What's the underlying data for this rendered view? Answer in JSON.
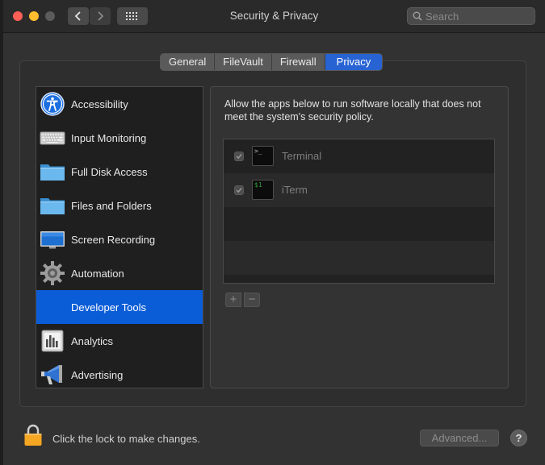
{
  "window": {
    "title": "Security & Privacy",
    "search_placeholder": "Search"
  },
  "tabs": [
    {
      "label": "General"
    },
    {
      "label": "FileVault"
    },
    {
      "label": "Firewall"
    },
    {
      "label": "Privacy",
      "active": true
    }
  ],
  "sidebar": {
    "items": [
      {
        "label": "Accessibility",
        "icon": "accessibility-icon"
      },
      {
        "label": "Input Monitoring",
        "icon": "keyboard-icon"
      },
      {
        "label": "Full Disk Access",
        "icon": "folder-icon"
      },
      {
        "label": "Files and Folders",
        "icon": "folder-icon"
      },
      {
        "label": "Screen Recording",
        "icon": "display-icon"
      },
      {
        "label": "Automation",
        "icon": "gear-icon"
      },
      {
        "label": "Developer Tools",
        "icon": "developer-tools-icon",
        "selected": true
      },
      {
        "label": "Analytics",
        "icon": "analytics-icon"
      },
      {
        "label": "Advertising",
        "icon": "megaphone-icon"
      }
    ]
  },
  "detail": {
    "description": "Allow the apps below to run software locally that does not meet the system's security policy.",
    "apps": [
      {
        "name": "Terminal",
        "checked": true,
        "icon": "terminal-icon",
        "icon_text": ">_"
      },
      {
        "name": "iTerm",
        "checked": true,
        "icon": "iterm-icon",
        "icon_text": "$1"
      }
    ],
    "add_label": "+",
    "remove_label": "−"
  },
  "footer": {
    "lock_text": "Click the lock to make changes.",
    "advanced_label": "Advanced...",
    "help_label": "?"
  },
  "colors": {
    "accent": "#2863d3",
    "selection": "#0a5cd7",
    "close": "#fe5f57",
    "minimize": "#febc2e",
    "lock": "#f5a623"
  }
}
